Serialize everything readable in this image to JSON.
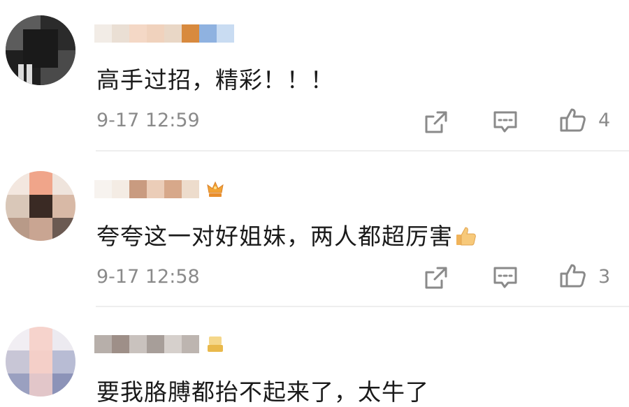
{
  "comments": [
    {
      "text": "高手过招，精彩！！！",
      "time": "9-17 12:59",
      "likes": "4",
      "icons": [
        "share-icon",
        "comment-icon",
        "thumbs-up-icon"
      ]
    },
    {
      "text": "夸夸这一对好姐妹，两人都超厉害",
      "time": "9-17 12:58",
      "likes": "3",
      "icons": [
        "share-icon",
        "comment-icon",
        "thumbs-up-icon",
        "thumbs-up-emoji-icon",
        "crown-badge-icon"
      ]
    },
    {
      "text": "要我胳膊都抬不起来了，太牛了",
      "icons": [
        "gold-badge-icon"
      ]
    }
  ],
  "colors": {
    "text": "#1a1a1a",
    "meta": "#8a8a8a",
    "divider": "#eeeeee",
    "icon": "#8a8a8a"
  }
}
